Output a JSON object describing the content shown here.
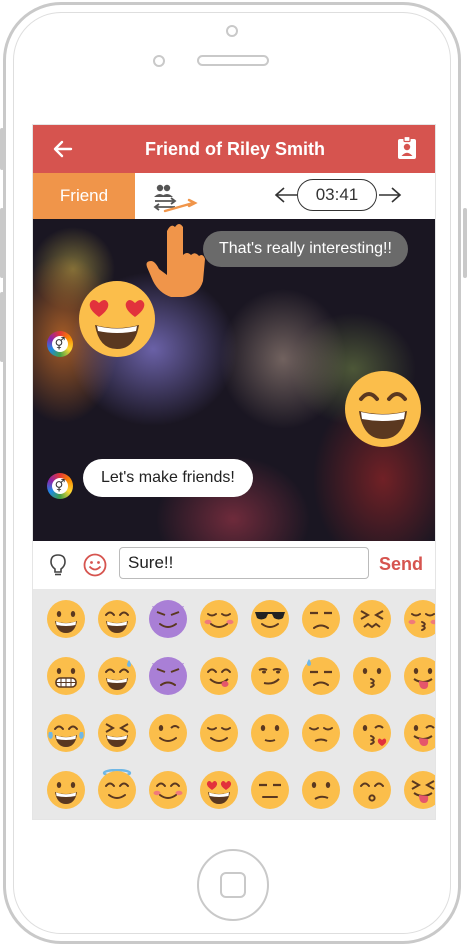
{
  "header": {
    "title": "Friend of Riley Smith",
    "back_icon": "arrow-left-icon",
    "profile_icon": "id-badge-icon"
  },
  "tabs": {
    "friend_label": "Friend",
    "swap_icon": "people-swap-icon",
    "timer": "03:41"
  },
  "chat": {
    "received_message": "That's really interesting!!",
    "sent_message": "Let's make friends!",
    "big_emoji_left": "heart-eyes-emoji",
    "big_emoji_right": "grin-emoji",
    "avatar_symbol": "⚥"
  },
  "composer": {
    "input_value": "Sure!!",
    "send_label": "Send"
  },
  "emoji_keyboard": {
    "rows": [
      [
        "grin",
        "smile",
        "devil-smile",
        "blush",
        "sunglasses",
        "unamused",
        "confounded",
        "kiss-blush"
      ],
      [
        "grimace",
        "sweat-smile",
        "devil-frown",
        "yum",
        "smirk",
        "sweat",
        "kiss",
        "tongue"
      ],
      [
        "joy",
        "squint-laugh",
        "wink",
        "relieved",
        "neutral-eyes",
        "pensive",
        "kiss-heart",
        "tongue-wink"
      ],
      [
        "open-smile",
        "innocent",
        "happy-blush",
        "heart-eyes",
        "expressionless",
        "confused",
        "whistle",
        "squint-tongue"
      ]
    ]
  },
  "colors": {
    "header": "#d6544f",
    "tab_active": "#f0954a",
    "send": "#d6544f",
    "emoji_face": "#fbbe4b",
    "devil": "#a97fd6"
  }
}
